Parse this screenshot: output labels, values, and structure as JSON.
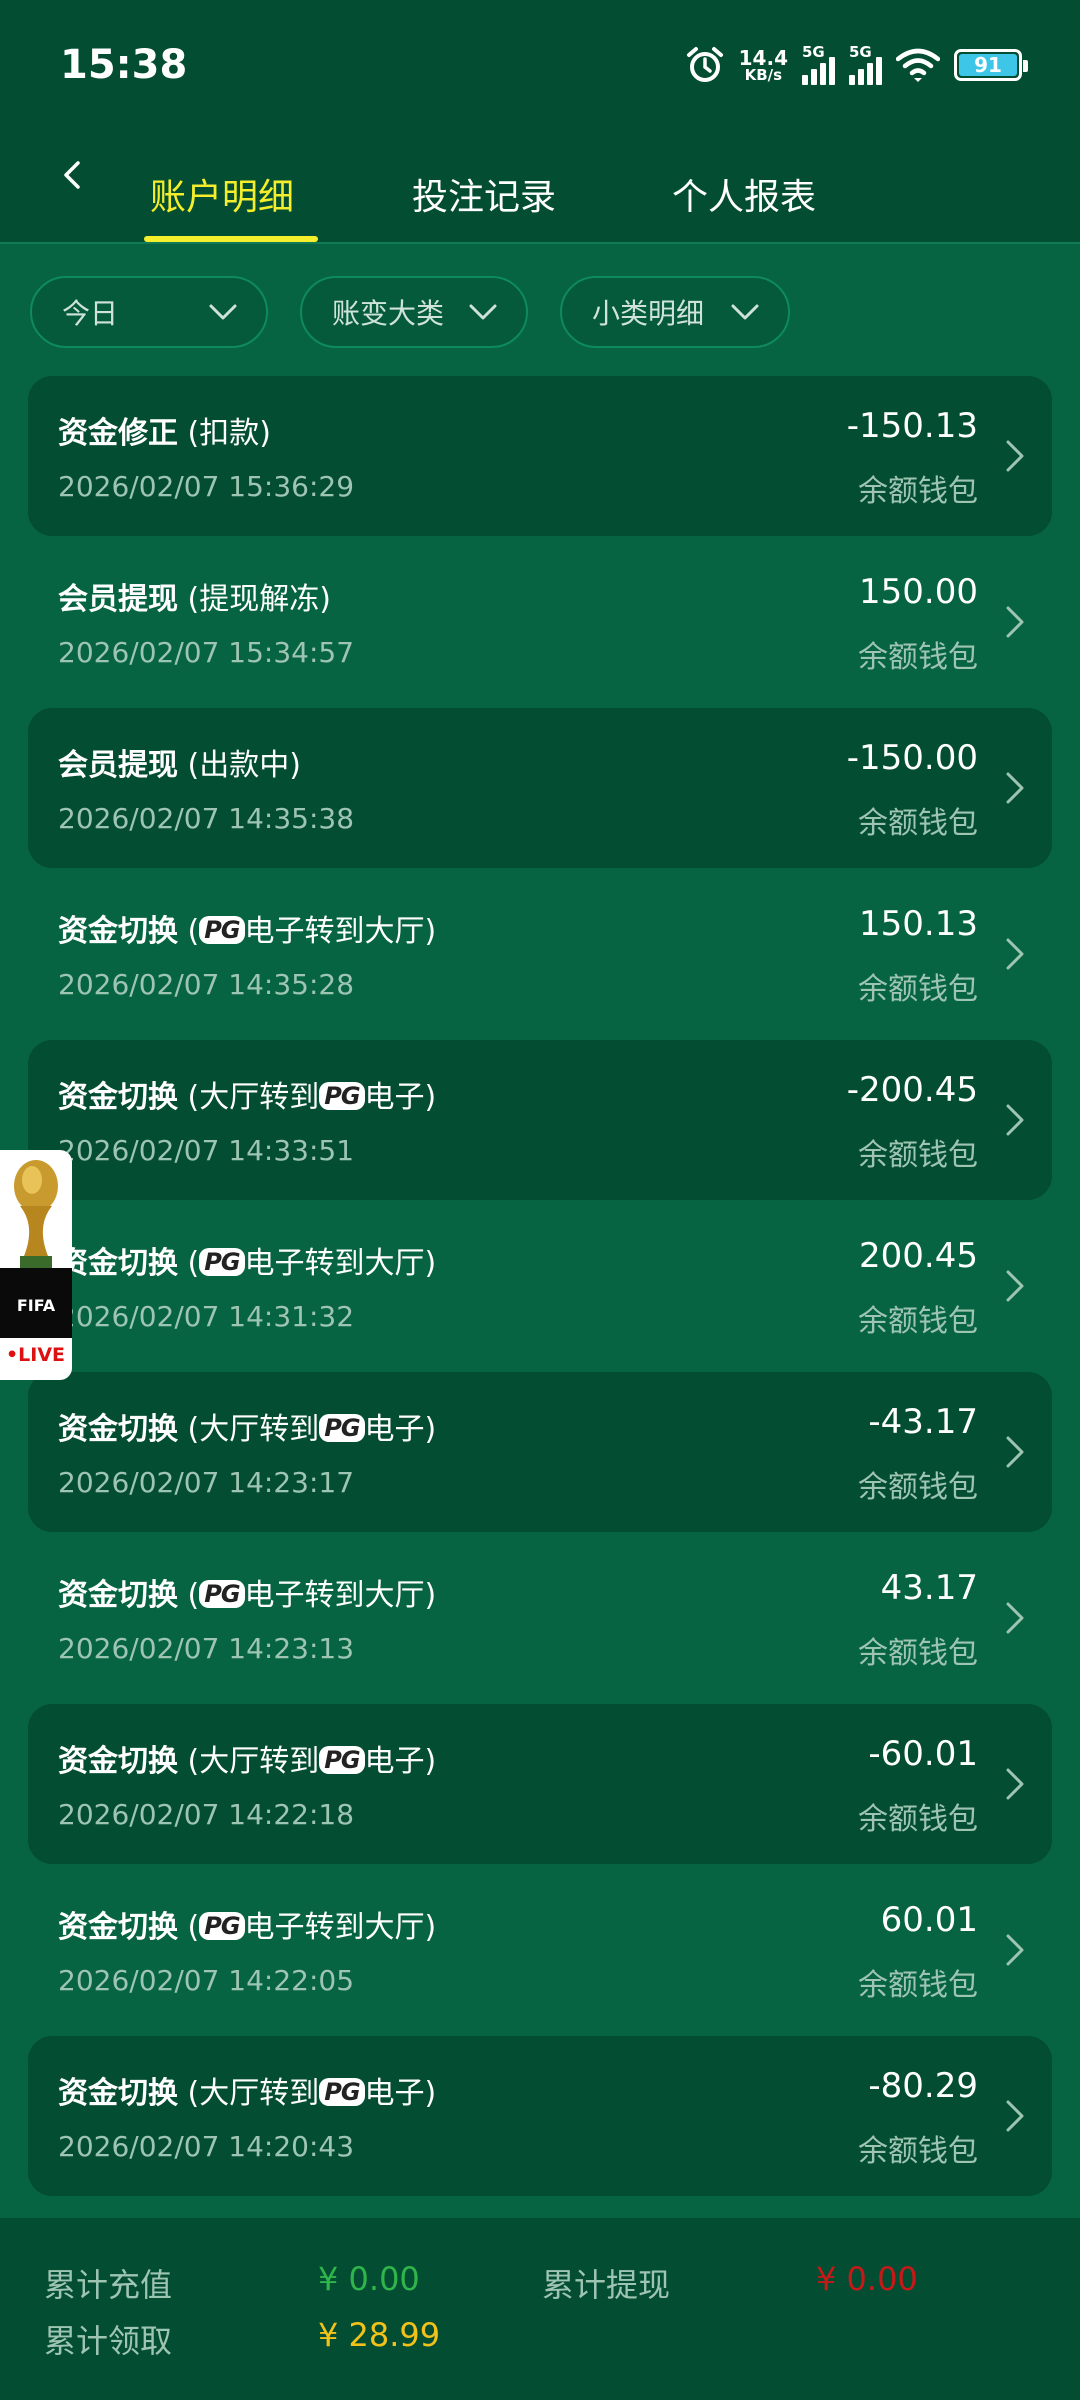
{
  "status_bar": {
    "time": "15:38",
    "net_speed_value": "14.4",
    "net_speed_unit": "KB/s",
    "sim1_label": "5G",
    "sim2_label": "5G",
    "battery_level": "91",
    "icons": [
      "alarm-icon",
      "signal-icon",
      "wifi-icon",
      "battery-icon"
    ]
  },
  "header": {
    "back_icon": "chevron-left-icon",
    "tabs": [
      {
        "label": "账户明细",
        "active": true
      },
      {
        "label": "投注记录",
        "active": false
      },
      {
        "label": "个人报表",
        "active": false
      }
    ]
  },
  "filters": [
    {
      "label": "今日"
    },
    {
      "label": "账变大类"
    },
    {
      "label": "小类明细"
    }
  ],
  "records": [
    {
      "type": "资金修正",
      "pre": " (扣款)",
      "pg": "",
      "post": "",
      "time": "2026/02/07 15:36:29",
      "amount": "-150.13",
      "wallet": "余额钱包"
    },
    {
      "type": "会员提现",
      "pre": " (提现解冻)",
      "pg": "",
      "post": "",
      "time": "2026/02/07 15:34:57",
      "amount": "150.00",
      "wallet": "余额钱包"
    },
    {
      "type": "会员提现",
      "pre": " (出款中)",
      "pg": "",
      "post": "",
      "time": "2026/02/07 14:35:38",
      "amount": "-150.00",
      "wallet": "余额钱包"
    },
    {
      "type": "资金切换",
      "pre": " (",
      "pg": "PG",
      "post": "电子转到大厅)",
      "time": "2026/02/07 14:35:28",
      "amount": "150.13",
      "wallet": "余额钱包"
    },
    {
      "type": "资金切换",
      "pre": " (大厅转到",
      "pg": "PG",
      "post": "电子)",
      "time": "2026/02/07 14:33:51",
      "amount": "-200.45",
      "wallet": "余额钱包"
    },
    {
      "type": "资金切换",
      "pre": " (",
      "pg": "PG",
      "post": "电子转到大厅)",
      "time": "2026/02/07 14:31:32",
      "amount": "200.45",
      "wallet": "余额钱包"
    },
    {
      "type": "资金切换",
      "pre": " (大厅转到",
      "pg": "PG",
      "post": "电子)",
      "time": "2026/02/07 14:23:17",
      "amount": "-43.17",
      "wallet": "余额钱包"
    },
    {
      "type": "资金切换",
      "pre": " (",
      "pg": "PG",
      "post": "电子转到大厅)",
      "time": "2026/02/07 14:23:13",
      "amount": "43.17",
      "wallet": "余额钱包"
    },
    {
      "type": "资金切换",
      "pre": " (大厅转到",
      "pg": "PG",
      "post": "电子)",
      "time": "2026/02/07 14:22:18",
      "amount": "-60.01",
      "wallet": "余额钱包"
    },
    {
      "type": "资金切换",
      "pre": " (",
      "pg": "PG",
      "post": "电子转到大厅)",
      "time": "2026/02/07 14:22:05",
      "amount": "60.01",
      "wallet": "余额钱包"
    },
    {
      "type": "资金切换",
      "pre": " (大厅转到",
      "pg": "PG",
      "post": "电子)",
      "time": "2026/02/07 14:20:43",
      "amount": "-80.29",
      "wallet": "余额钱包"
    }
  ],
  "floating_badge": {
    "brand": "FIFA",
    "live": "•LIVE"
  },
  "summary": {
    "recharge_label": "累计充值",
    "recharge_value": "¥ 0.00",
    "withdraw_label": "累计提现",
    "withdraw_value": "¥ 0.00",
    "claim_label": "累计领取",
    "claim_value": "¥ 28.99"
  },
  "colors": {
    "background": "#066443",
    "header_bg": "#034d33",
    "active_tab": "#f4ee2c",
    "recharge": "#2fb54a",
    "withdraw": "#c81818",
    "claim": "#f2c21b"
  }
}
